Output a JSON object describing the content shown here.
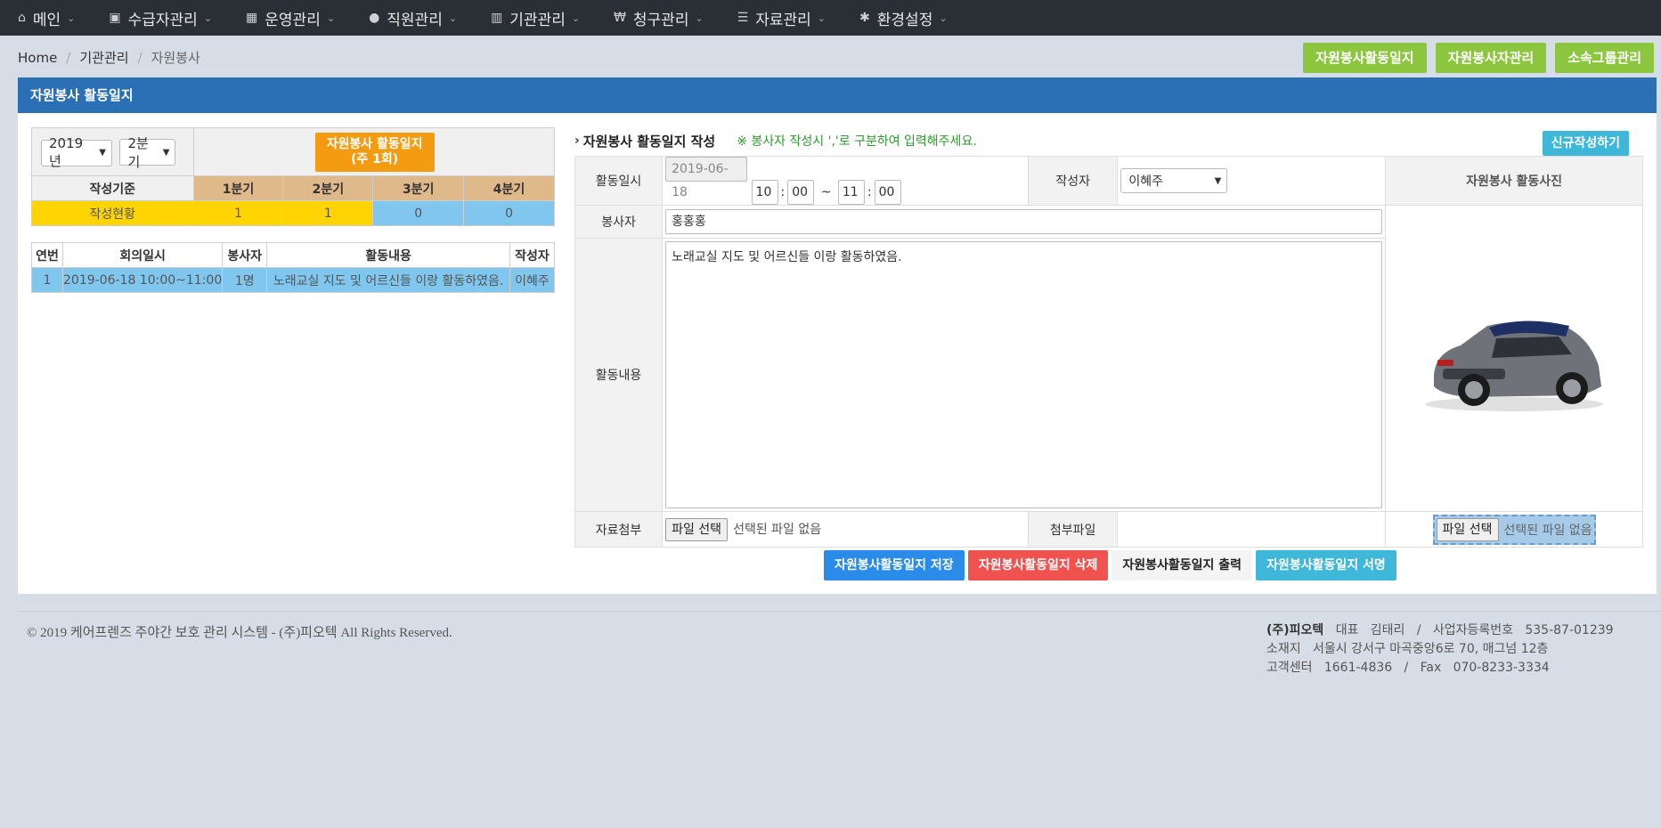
{
  "nav": [
    {
      "label": "메인",
      "icon": "home-icon",
      "glyph": "⌂"
    },
    {
      "label": "수급자관리",
      "icon": "id-card-icon",
      "glyph": "▣"
    },
    {
      "label": "운영관리",
      "icon": "calendar-icon",
      "glyph": "▦"
    },
    {
      "label": "직원관리",
      "icon": "users-icon",
      "glyph": "●"
    },
    {
      "label": "기관관리",
      "icon": "building-icon",
      "glyph": "▥"
    },
    {
      "label": "청구관리",
      "icon": "won-icon",
      "glyph": "₩"
    },
    {
      "label": "자료관리",
      "icon": "list-icon",
      "glyph": "☰"
    },
    {
      "label": "환경설정",
      "icon": "gear-icon",
      "glyph": "✱"
    }
  ],
  "breadcrumb": [
    "Home",
    "기관관리",
    "자원봉사"
  ],
  "top_buttons": [
    "자원봉사활동일지",
    "자원봉사자관리",
    "소속그룹관리"
  ],
  "panel_title": "자원봉사 활동일지",
  "summary": {
    "year": "2019 년",
    "quarter": "2분기",
    "orange_line1": "자원봉사 활동일지",
    "orange_line2": "(주 1회)",
    "basis_label": "작성기준",
    "quarters": [
      "1분기",
      "2분기",
      "3분기",
      "4분기"
    ],
    "status_label": "작성현황",
    "counts": [
      "1",
      "1",
      "0",
      "0"
    ]
  },
  "list": {
    "headers": [
      "연번",
      "회의일시",
      "봉사자",
      "활동내용",
      "작성자"
    ],
    "rows": [
      {
        "no": "1",
        "datetime": "2019-06-18 10:00~11:00",
        "volunteers": "1명",
        "content": "노래교실 지도 및 어르신들 이랑 활동하였음.",
        "writer": "이혜주"
      }
    ]
  },
  "form": {
    "title": "자원봉사 활동일지 작성",
    "note": "※ 봉사자 작성시 ','로 구분하여 입력해주세요.",
    "new_button": "신규작성하기",
    "date_label": "활동일시",
    "date": "2019-06-18",
    "start_hour": "10",
    "start_min": "00",
    "tilde": "~",
    "end_hour": "11",
    "end_min": "00",
    "writer_label": "작성자",
    "writer": "이혜주",
    "photo_label": "자원봉사 활동사진",
    "volunteer_label": "봉사자",
    "volunteer": "홍홍홍",
    "content_label": "활동내용",
    "content": "노래교실 지도 및 어르신들 이랑 활동하였음.",
    "attach_label": "자료첨부",
    "file_button": "파일 선택",
    "no_file": "선택된 파일 없음",
    "attached_label": "첨부파일"
  },
  "actions": [
    "자원봉사활동일지 저장",
    "자원봉사활동일지 삭제",
    "자원봉사활동일지 출력",
    "자원봉사활동일지 서명"
  ],
  "footer": {
    "copyright": "© 2019 케어프렌즈 주야간 보호 관리 시스템 - (주)피오텍 All Rights Reserved.",
    "company": "(주)피오텍",
    "line1": "대표   김태리   /   사업자등록번호   535-87-01239",
    "line2": "소재지   서울시 강서구 마곡중앙6로 70, 매그넘 12층",
    "line3": "고객센터   1661-4836   /   Fax   070-8233-3334"
  }
}
